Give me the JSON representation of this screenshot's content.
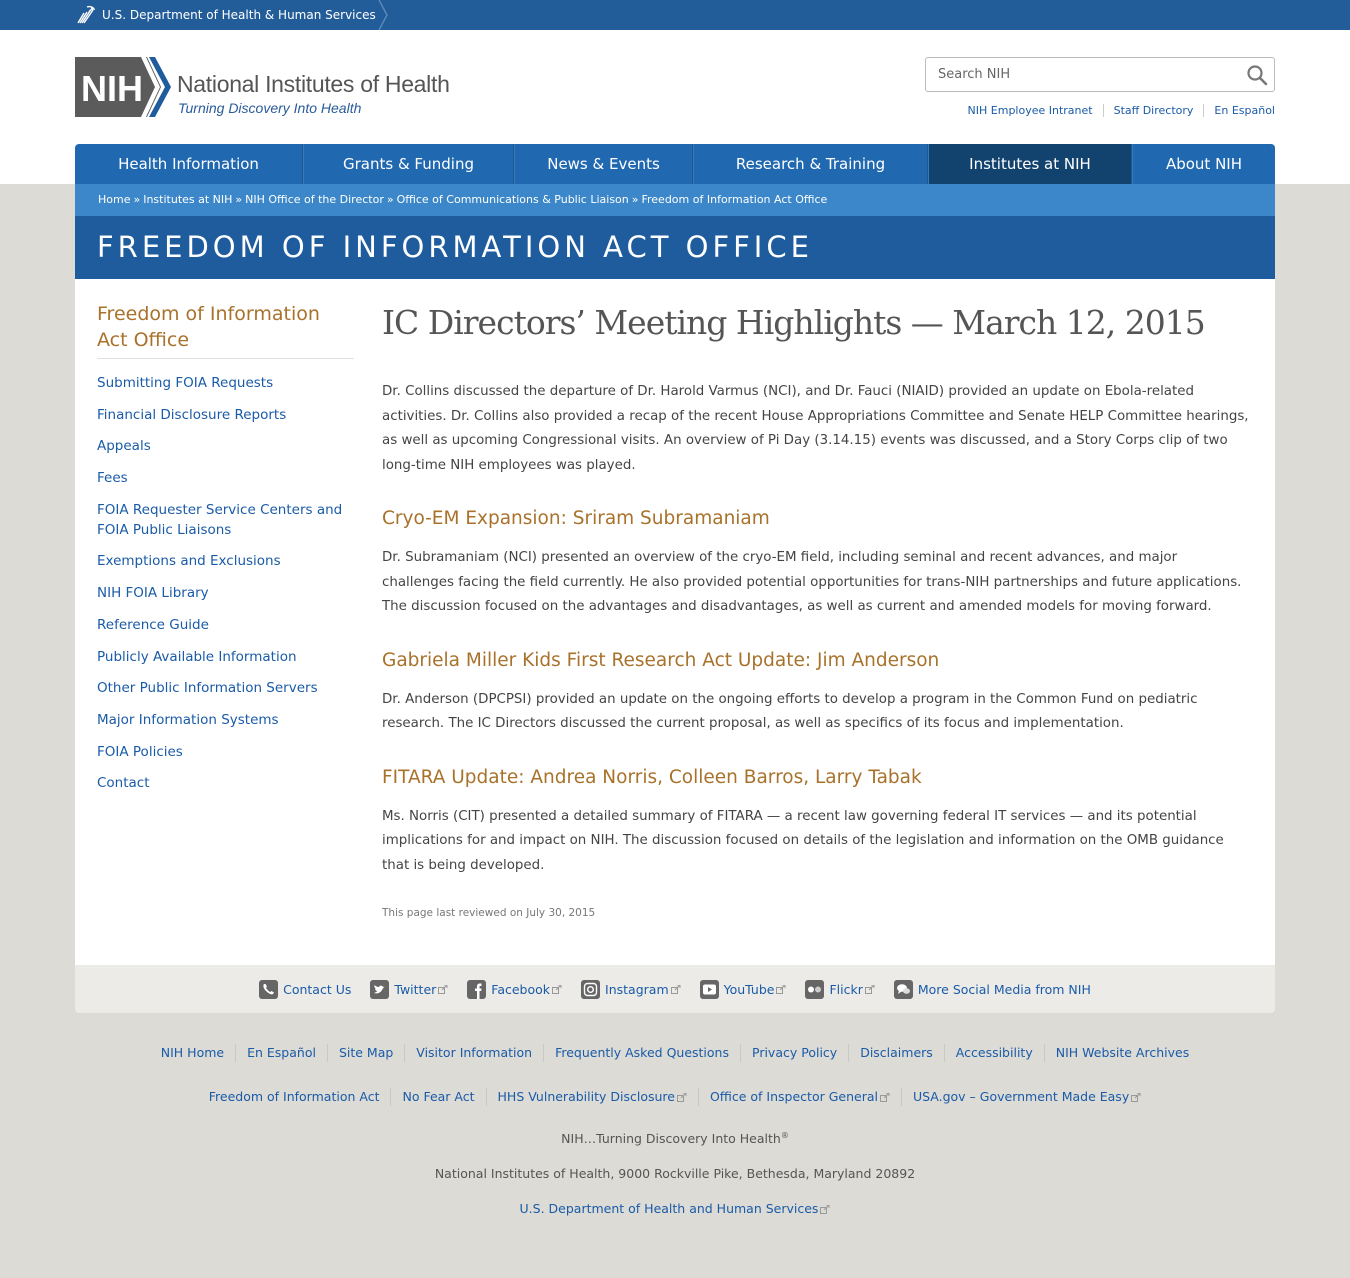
{
  "hhs_bar": {
    "label": "U.S. Department of Health & Human Services"
  },
  "logo": {
    "mark": "NIH",
    "title": "National Institutes of Health",
    "tagline": "Turning Discovery Into Health"
  },
  "search": {
    "placeholder": "Search NIH"
  },
  "utility_links": [
    "NIH Employee Intranet",
    "Staff Directory",
    "En Español"
  ],
  "nav": {
    "items": [
      {
        "label": "Health Information"
      },
      {
        "label": "Grants & Funding"
      },
      {
        "label": "News & Events"
      },
      {
        "label": "Research & Training"
      },
      {
        "label": "Institutes at NIH",
        "active": true
      },
      {
        "label": "About NIH"
      }
    ]
  },
  "breadcrumb": [
    "Home",
    "Institutes at NIH",
    "NIH Office of the Director",
    "Office of Communications & Public Liaison",
    "Freedom of Information Act Office"
  ],
  "breadcrumb_separator": "»",
  "banner": {
    "title": "FREEDOM OF INFORMATION ACT OFFICE"
  },
  "sidebar": {
    "title": "Freedom of Information Act Office",
    "items": [
      "Submitting FOIA Requests",
      "Financial Disclosure Reports",
      "Appeals",
      "Fees",
      "FOIA Requester Service Centers and FOIA Public Liaisons",
      "Exemptions and Exclusions",
      "NIH FOIA Library",
      "Reference Guide",
      "Publicly Available Information",
      "Other Public Information Servers",
      "Major Information Systems",
      "FOIA Policies",
      "Contact"
    ]
  },
  "main": {
    "title": "IC Directors’ Meeting Highlights — March 12, 2015",
    "intro": "Dr. Collins discussed the departure of Dr. Harold Varmus (NCI), and Dr. Fauci (NIAID) provided an update on Ebola-related activities. Dr. Collins also provided a recap of the recent House Appropriations Committee and Senate HELP Committee hearings, as well as upcoming Congressional visits. An overview of Pi Day (3.14.15) events was discussed, and a Story Corps clip of two long-time NIH employees was played.",
    "sections": [
      {
        "heading": "Cryo-EM Expansion: Sriram Subramaniam",
        "body": "Dr. Subramaniam (NCI) presented an overview of the cryo-EM field, including seminal and recent advances, and major challenges facing the field currently. He also provided potential opportunities for trans-NIH partnerships and future applications. The discussion focused on the advantages and disadvantages, as well as current and amended models for moving forward."
      },
      {
        "heading": "Gabriela Miller Kids First Research Act Update: Jim Anderson",
        "body": "Dr. Anderson (DPCPSI) provided an update on the ongoing efforts to develop a program in the Common Fund on pediatric research. The IC Directors discussed the current proposal, as well as specifics of its focus and implementation."
      },
      {
        "heading": "FITARA Update: Andrea Norris, Colleen Barros, Larry Tabak",
        "body": "Ms. Norris (CIT) presented a detailed summary of FITARA — a recent law governing federal IT services — and its potential implications for and impact on NIH. The discussion focused on details of the legislation and information on the OMB guidance that is being developed."
      }
    ],
    "last_reviewed": "This page last reviewed on July 30, 2015"
  },
  "social": {
    "items": [
      {
        "label": "Contact Us",
        "icon": "phone-icon",
        "external": false
      },
      {
        "label": "Twitter",
        "icon": "twitter-icon",
        "external": true
      },
      {
        "label": "Facebook",
        "icon": "facebook-icon",
        "external": true
      },
      {
        "label": "Instagram",
        "icon": "instagram-icon",
        "external": true
      },
      {
        "label": "YouTube",
        "icon": "youtube-icon",
        "external": true
      },
      {
        "label": "Flickr",
        "icon": "flickr-icon",
        "external": true
      },
      {
        "label": "More Social Media from NIH",
        "icon": "chat-bubbles-icon",
        "external": false
      }
    ]
  },
  "footer": {
    "row1": [
      "NIH Home",
      "En Español",
      "Site Map",
      "Visitor Information",
      "Frequently Asked Questions",
      "Privacy Policy",
      "Disclaimers",
      "Accessibility",
      "NIH Website Archives"
    ],
    "row2": [
      {
        "label": "Freedom of Information Act",
        "external": false
      },
      {
        "label": "No Fear Act",
        "external": false
      },
      {
        "label": "HHS Vulnerability Disclosure",
        "external": true
      },
      {
        "label": "Office of Inspector General",
        "external": true
      },
      {
        "label": "USA.gov – Government Made Easy",
        "external": true
      }
    ],
    "tagline": "NIH…Turning Discovery Into Health",
    "tagline_mark": "®",
    "address": "National Institutes of Health, 9000 Rockville Pike, Bethesda, Maryland 20892",
    "hhs_link": "U.S. Department of Health and Human Services"
  },
  "colors": {
    "hhs_bar": "#235d99",
    "nav": "#2068b0",
    "nav_active": "#12436f",
    "breadcrumb": "#3b87c9",
    "banner": "#1e5c9e",
    "heading_gold": "#a8722b",
    "link": "#1a5ba8",
    "page_bg": "#dcdbd6"
  }
}
